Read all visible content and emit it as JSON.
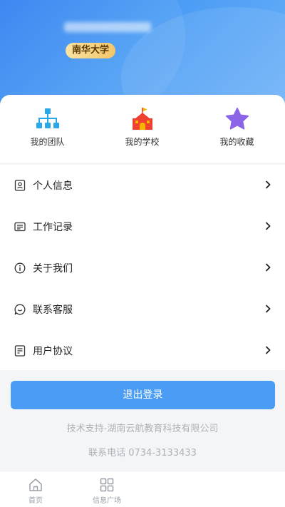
{
  "header": {
    "school_badge": "南华大学"
  },
  "quick_actions": [
    {
      "label": "我的团队",
      "icon": "team-tree-icon",
      "color": "#2aa7e8"
    },
    {
      "label": "我的学校",
      "icon": "school-building-icon",
      "color": "#f0402f"
    },
    {
      "label": "我的收藏",
      "icon": "star-icon",
      "color": "#8b64e8"
    }
  ],
  "menu": {
    "items": [
      {
        "label": "个人信息",
        "icon": "profile-card-icon"
      },
      {
        "label": "工作记录",
        "icon": "record-card-icon"
      },
      {
        "label": "关于我们",
        "icon": "info-icon"
      },
      {
        "label": "联系客服",
        "icon": "chat-bubble-icon"
      },
      {
        "label": "用户协议",
        "icon": "agreement-doc-icon"
      }
    ]
  },
  "logout_label": "退出登录",
  "footer": {
    "support": "技术支持-湖南云航教育科技有限公司",
    "phone": "联系电话 0734-3133433"
  },
  "tabbar": {
    "items": [
      {
        "label": "首页",
        "icon": "home-icon"
      },
      {
        "label": "信息广场",
        "icon": "grid-icon"
      }
    ]
  },
  "colors": {
    "header_gradient_start": "#2f7ff0",
    "header_gradient_end": "#6fb3f8",
    "accent": "#4a9cf5",
    "badge_gold": "#f2c568"
  }
}
